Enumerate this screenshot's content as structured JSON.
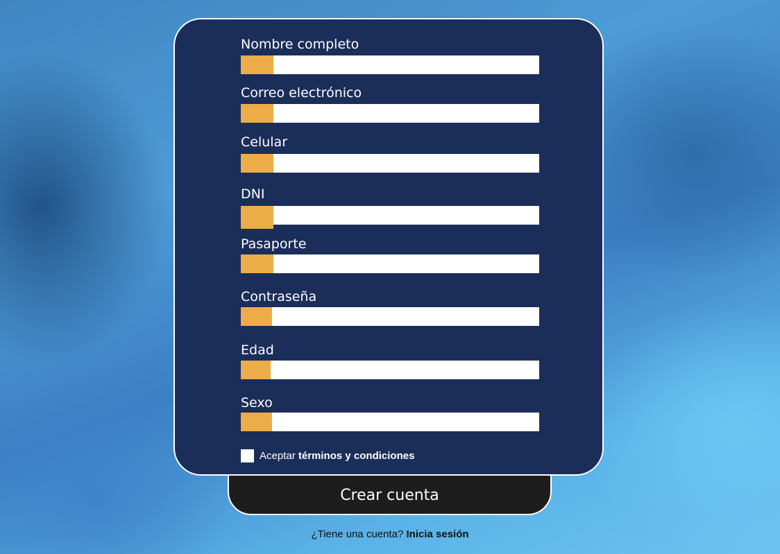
{
  "form": {
    "fields": [
      {
        "label": "Nombre completo",
        "value": ""
      },
      {
        "label": "Correo electrónico",
        "value": ""
      },
      {
        "label": "Celular",
        "value": ""
      },
      {
        "label": "DNI",
        "value": ""
      },
      {
        "label": "Pasaporte",
        "value": ""
      },
      {
        "label": "Contraseña",
        "value": ""
      },
      {
        "label": "Edad",
        "value": ""
      },
      {
        "label": "Sexo",
        "value": ""
      }
    ],
    "terms": {
      "prefix": "Aceptar",
      "link": "términos y condiciones",
      "checked": false
    },
    "submit_label": "Crear cuenta"
  },
  "footer": {
    "question": "¿Tiene una cuenta?",
    "login_link": "Inicia sesión"
  },
  "colors": {
    "card_background": "#1b2d59",
    "input_accent": "#ecad49",
    "button_background": "#1d1d1d"
  }
}
